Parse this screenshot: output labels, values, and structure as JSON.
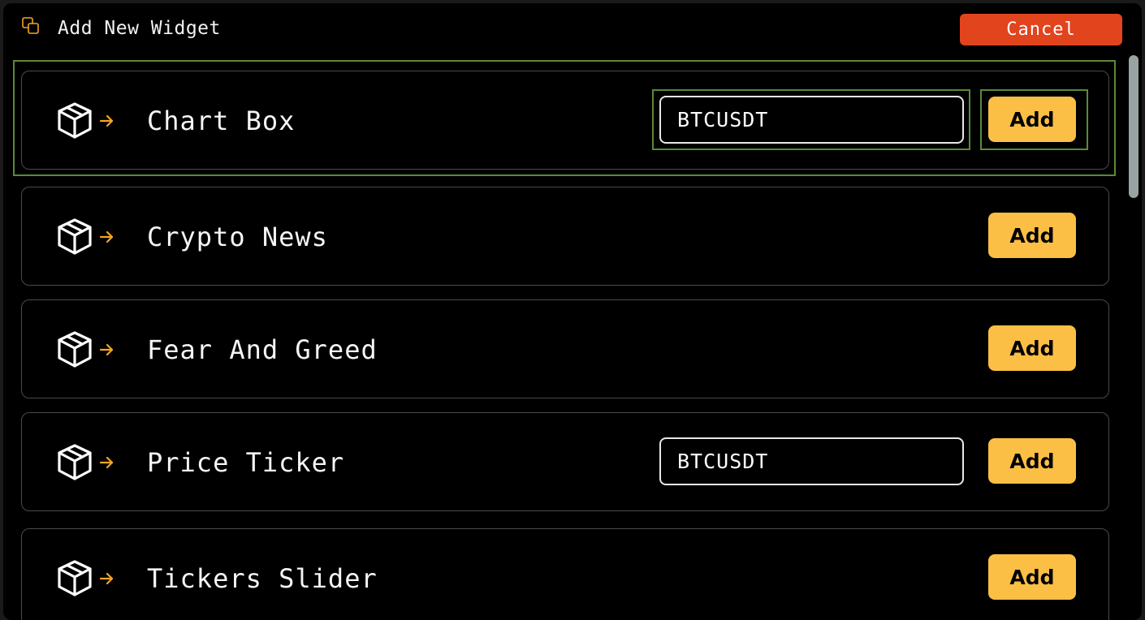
{
  "header": {
    "title": "Add New Widget",
    "cancel_label": "Cancel",
    "icon": "copy-icon"
  },
  "widgets": [
    {
      "label": "Chart Box",
      "has_symbol": true,
      "symbol": "BTCUSDT",
      "add_label": "Add",
      "icon": "box-arrow-icon"
    },
    {
      "label": "Crypto News",
      "has_symbol": false,
      "add_label": "Add",
      "icon": "box-arrow-icon"
    },
    {
      "label": "Fear And Greed",
      "has_symbol": false,
      "add_label": "Add",
      "icon": "box-arrow-icon"
    },
    {
      "label": "Price Ticker",
      "has_symbol": true,
      "symbol": "BTCUSDT",
      "add_label": "Add",
      "icon": "box-arrow-icon"
    },
    {
      "label": "Tickers Slider",
      "has_symbol": false,
      "add_label": "Add",
      "icon": "box-arrow-icon"
    }
  ],
  "colors": {
    "accent_orange": "#e2441d",
    "add_button": "#fbbf45",
    "focus_outline": "#5a8a3a",
    "icon_arrow": "#f5a623"
  }
}
